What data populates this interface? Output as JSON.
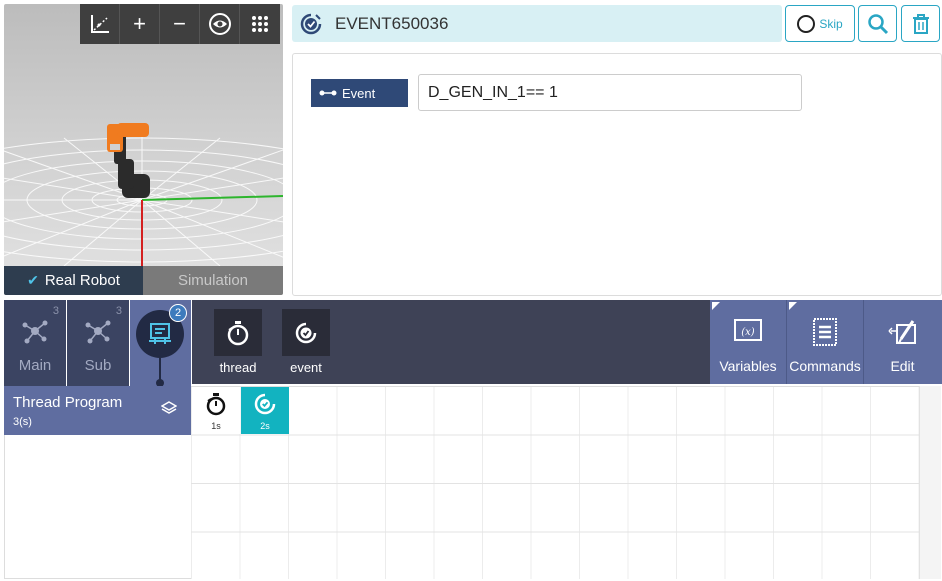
{
  "viewport": {
    "toolbar": [
      "axes-icon",
      "zoom-in-icon",
      "zoom-out-icon",
      "eye-icon",
      "grid-icon"
    ],
    "mode_real": "Real Robot",
    "mode_sim": "Simulation"
  },
  "command": {
    "title": "EVENT650036",
    "skip_label": "Skip"
  },
  "properties": {
    "event_label": "Event",
    "condition": "D_GEN_IN_1== 1"
  },
  "tabs": {
    "main": {
      "label": "Main",
      "count": "3"
    },
    "sub": {
      "label": "Sub",
      "count": "3"
    },
    "thread": {
      "count": "2"
    }
  },
  "program": {
    "title": "Thread Program",
    "time": "3(s)"
  },
  "palette": {
    "thread": "thread",
    "event": "event"
  },
  "right_buttons": {
    "variables": "Variables",
    "commands": "Commands",
    "edit": "Edit"
  },
  "timeline": {
    "thread_time": "1s",
    "event_time": "2s"
  },
  "colors": {
    "accent": "#2aa6c4",
    "nav": "#5f6da0",
    "event_active": "#12b3c0"
  }
}
